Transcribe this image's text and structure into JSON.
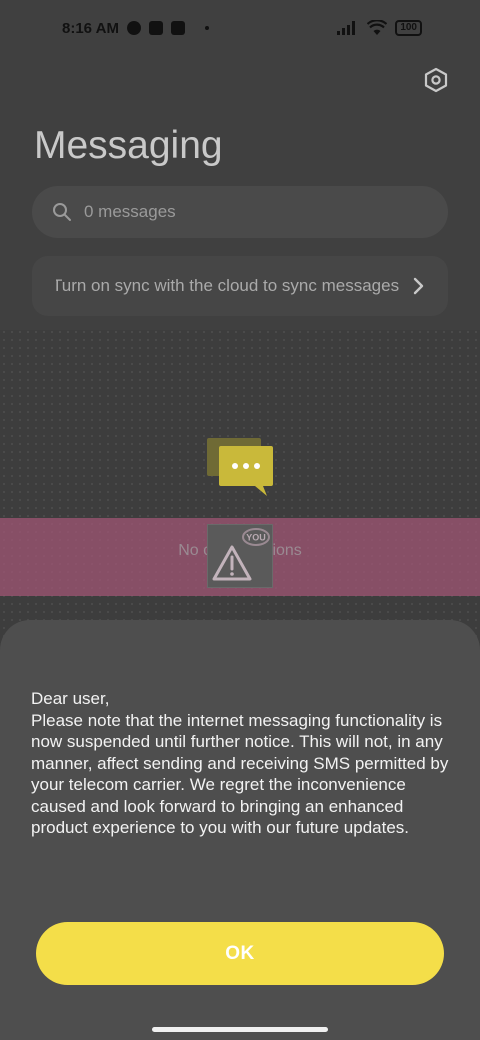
{
  "status_bar": {
    "time": "8:16 AM",
    "battery": "100",
    "icons": [
      "sync-icon",
      "square-icon",
      "upload-icon",
      "dot-icon",
      "signal-icon",
      "wifi-icon",
      "battery-icon"
    ]
  },
  "header": {
    "title": "Messaging",
    "settings_icon": "settings-hexagon-icon"
  },
  "search": {
    "icon": "search-icon",
    "text": "0 messages"
  },
  "sync_banner": {
    "text": "Turn on sync with the cloud to sync messages",
    "icon": "chevron-right-icon"
  },
  "empty_state": {
    "icon": "chat-bubbles-icon",
    "text": "No conversations",
    "overlay_icon": "warning-sticker-icon",
    "overlay_label": "YOU"
  },
  "dialog": {
    "message": "Dear user,\nPlease note that the internet messaging functionality is now suspended until further notice. This will not, in any manner, affect sending and receiving SMS permitted by your telecom carrier. We regret the inconvenience caused and look forward to bringing an enhanced product experience to you with our future updates.",
    "ok_label": "OK"
  },
  "colors": {
    "accent": "#f4de49",
    "overlay_band": "#a05674",
    "background": "#3d3d3d",
    "sheet": "#4e4e4e"
  }
}
